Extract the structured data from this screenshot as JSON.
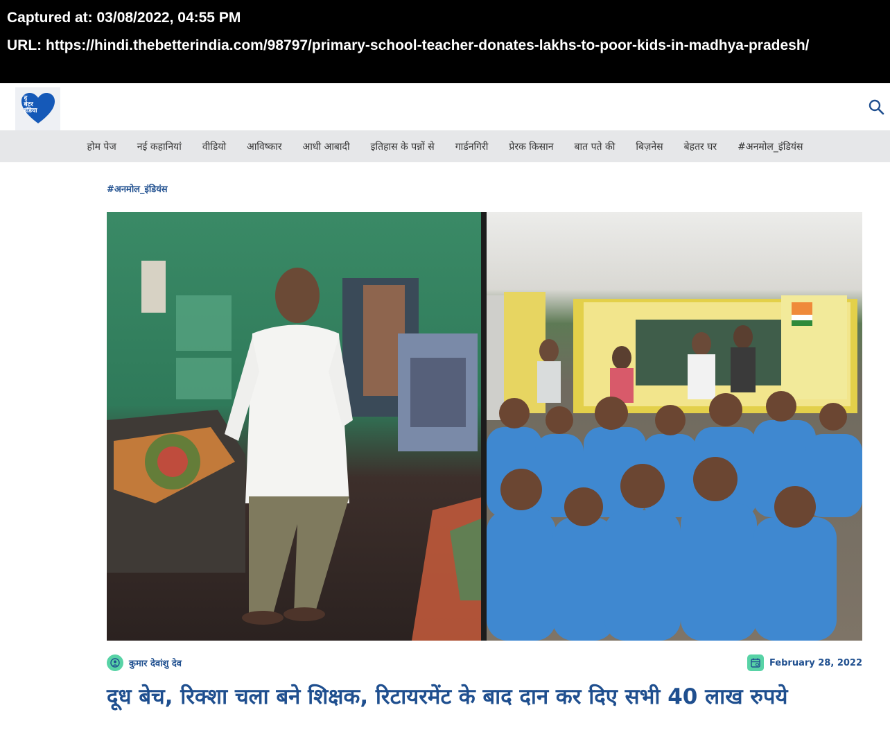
{
  "capture": {
    "captured_at": "Captured at: 03/08/2022, 04:55 PM",
    "url": "URL: https://hindi.thebetterindia.com/98797/primary-school-teacher-donates-lakhs-to-poor-kids-in-madhya-pradesh/"
  },
  "header": {
    "logo_text": [
      "द",
      "बेटर",
      "इंडिया"
    ],
    "search_icon": "search-icon"
  },
  "nav": {
    "items": [
      "होम पेज",
      "नई कहानियां",
      "वीडियो",
      "आविष्कार",
      "आधी आबादी",
      "इतिहास के पन्नों से",
      "गार्डनगिरी",
      "प्रेरक किसान",
      "बात पते की",
      "बिज़नेस",
      "बेहतर घर",
      "#अनमोल_इंडियंस"
    ]
  },
  "article": {
    "category": "#अनमोल_इंडियंस",
    "author": "कुमार देवांशु देव",
    "author_icon": "user-icon",
    "date": "February 28, 2022",
    "date_icon": "calendar-icon",
    "headline": "दूध बेच, रिक्शा चला बने शिक्षक, रिटायरमेंट के बाद दान कर दिए सभी 40 लाख रुपये"
  },
  "colors": {
    "accent": "#1f4f8f",
    "icon_green": "#58d3a6",
    "nav_bg": "#e6e7e9",
    "logo_blue": "#1559b8"
  }
}
